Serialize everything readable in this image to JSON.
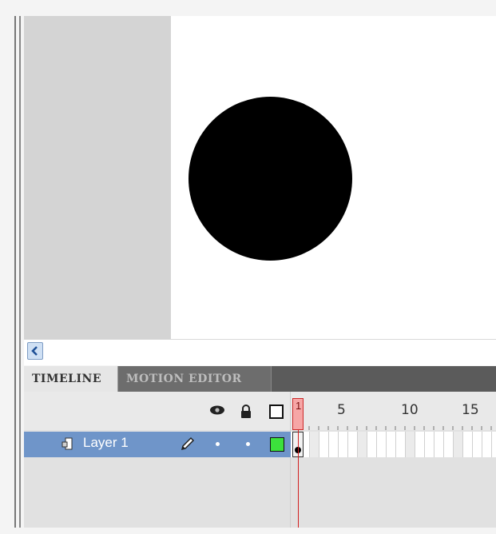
{
  "scroll": {
    "left_icon": "chevron-left-icon"
  },
  "tabs": [
    {
      "label": "TIMELINE",
      "active": true
    },
    {
      "label": "MOTION EDITOR",
      "active": false
    }
  ],
  "timeline": {
    "header_icons": [
      "eye-icon",
      "lock-icon",
      "outline-icon"
    ],
    "ruler": [
      "5",
      "10",
      "15"
    ],
    "playhead_frame": "1",
    "layers": [
      {
        "name": "Layer 1",
        "selected": true,
        "outline_color": "#3ce13c"
      }
    ]
  },
  "colors": {
    "accent_selection": "#6f95c9",
    "playhead": "#d21f1f",
    "stage": "#ffffff",
    "pasteboard": "#d4d4d4"
  }
}
